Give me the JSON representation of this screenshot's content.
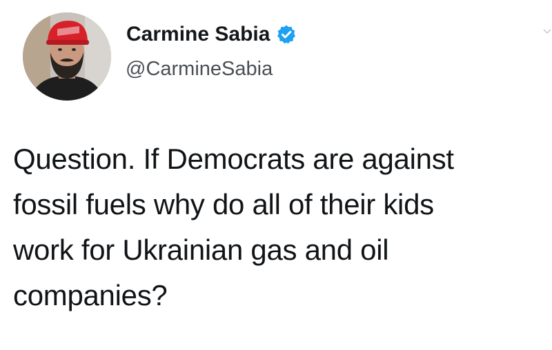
{
  "tweet": {
    "author": {
      "display_name": "Carmine Sabia",
      "handle": "@CarmineSabia",
      "verified": true,
      "verified_icon": "verified-badge-icon",
      "avatar_icon": "profile-photo"
    },
    "text_lines": [
      "Question. If Democrats are against",
      "fossil fuels why do all of their kids",
      "work for Ukrainian gas and oil",
      "companies?"
    ]
  },
  "colors": {
    "background": "#ffffff",
    "text": "#14171a",
    "handle": "#4a4f55",
    "verified": "#1da1f2"
  }
}
